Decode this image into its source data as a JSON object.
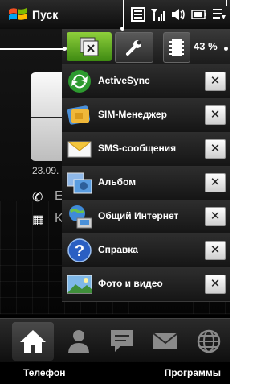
{
  "statusbar": {
    "start_label": "Пуск",
    "icons": [
      "windows-flag-icon",
      "connectivity-icon",
      "signal-icon",
      "volume-icon",
      "battery-icon",
      "notification-icon"
    ]
  },
  "home": {
    "date": "23.09.",
    "ghost_letter_1": "E",
    "ghost_letter_2": "K"
  },
  "quick_toolbar": {
    "buttons": [
      "task-manager-icon",
      "settings-icon",
      "memory-icon"
    ],
    "memory_percent": "43 %"
  },
  "tasks": [
    {
      "label": "ActiveSync",
      "icon": "activesync-icon"
    },
    {
      "label": "SIM-Менеджер",
      "icon": "sim-manager-icon"
    },
    {
      "label": "SMS-сообщения",
      "icon": "sms-icon"
    },
    {
      "label": "Альбом",
      "icon": "album-icon"
    },
    {
      "label": "Общий Интернет",
      "icon": "internet-sharing-icon"
    },
    {
      "label": "Справка",
      "icon": "help-icon"
    },
    {
      "label": "Фото и видео",
      "icon": "photos-videos-icon"
    }
  ],
  "close_glyph": "✕",
  "dock": {
    "tabs": [
      "home-icon",
      "people-icon",
      "messages-icon",
      "mail-icon",
      "internet-icon"
    ],
    "active": "home-icon"
  },
  "softkeys": {
    "left": "Телефон",
    "right": "Программы"
  },
  "colors": {
    "accent_green": "#5fae1e",
    "activesync_green": "#2d9a2f",
    "help_blue": "#2a5fc2"
  }
}
